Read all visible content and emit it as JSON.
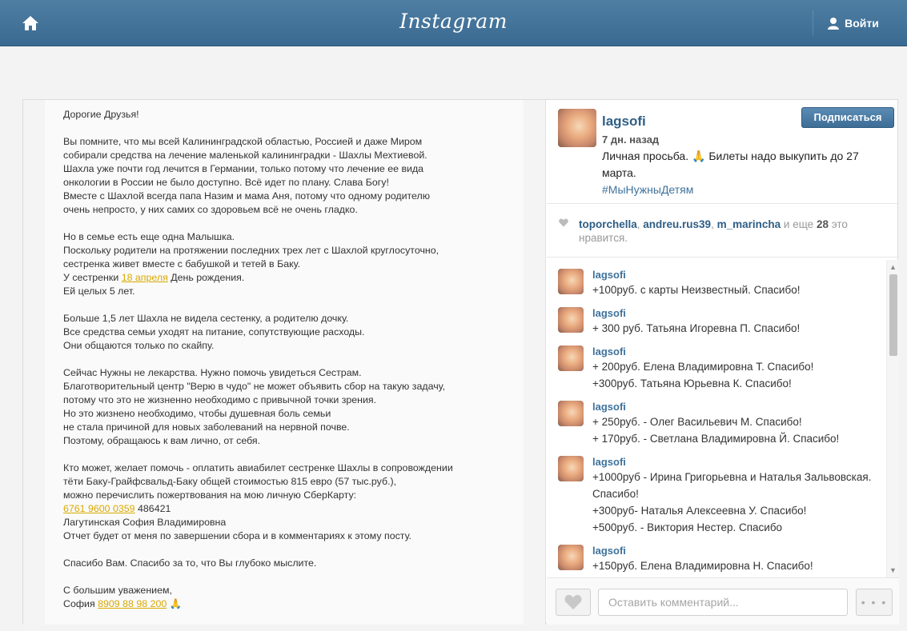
{
  "topbar": {
    "logo": "Instagram",
    "login_label": "Войти"
  },
  "letter": {
    "paragraphs": [
      [
        {
          "text": "Дорогие Друзья!"
        }
      ],
      [
        {
          "text": "Вы помните, что мы всей Калининградской областью, Россией и даже Миром"
        },
        {
          "text": "собирали средства на лечение маленькой калининградки - Шахлы Мехтиевой."
        },
        {
          "text": "Шахла уже почти год лечится в Германии, только потому что лечение ее вида"
        },
        {
          "text": "онкологии в России не было доступно. Всё идет по плану. Слава Богу!"
        },
        {
          "text": "Вместе с Шахлой всегда папа Назим и мама Аня, потому что одному родителю"
        },
        {
          "text": "очень непросто, у них самих со здоровьем всё не очень гладко."
        }
      ],
      [
        {
          "text": "Но в семье есть еще одна Малышка."
        },
        {
          "text": "Поскольку родители на протяжении последних трех лет с Шахлой круглосуточно,"
        },
        {
          "text": "сестренка живет вместе с бабушкой и тетей в Баку."
        },
        {
          "text": "У сестренки ",
          "hl": "18 апреля",
          "tail": " День рождения."
        },
        {
          "text": "Ей целых 5 лет."
        }
      ],
      [
        {
          "text": "Больше 1,5 лет Шахла не видела сестенку, а родителю дочку."
        },
        {
          "text": "Все средства семьи уходят на питание, сопутствующие расходы."
        },
        {
          "text": "Они общаются только по скайпу."
        }
      ],
      [
        {
          "text": "Сейчас Нужны не лекарства. Нужно помочь увидеться Сестрам."
        },
        {
          "text": "Благотворительный центр \"Верю в чудо\" не может объявить сбор на такую задачу,"
        },
        {
          "text": "потому что это не жизненно необходимо с привычной точки зрения."
        },
        {
          "text": "Но это жизнено необходимо, чтобы душевная боль семьи"
        },
        {
          "text": "не стала причиной для новых заболеваний на нервной почве."
        },
        {
          "text": "Поэтому, обращаюсь к вам лично, от себя."
        }
      ],
      [
        {
          "text": "Кто может, желает помочь - оплатить авиабилет  сестренке Шахлы в сопровождении"
        },
        {
          "text": "тёти Баку-Грайфсвальд-Баку  общей стоимостью 815 евро (57 тыс.руб.),"
        },
        {
          "text": "можно перечислить пожертвования на мою личную СберКарту:"
        },
        {
          "text": "",
          "hl": "6761 9600 0359",
          "tail": " 486421"
        },
        {
          "text": "Лагутинская София Владимировна"
        },
        {
          "text": "Отчет будет от меня по завершении сбора и в комментариях к этому посту."
        }
      ],
      [
        {
          "text": "Спасибо Вам. Спасибо за то, что Вы глубоко мыслите."
        }
      ],
      [
        {
          "text": "С большим уважением,"
        },
        {
          "text": "София  ",
          "hl": "8909 88 98 200",
          "tail": " 🙏"
        }
      ]
    ]
  },
  "post": {
    "username": "lagsofi",
    "follow_label": "Подписаться",
    "time": "7 дн. назад",
    "caption": "Личная просьба. 🙏 Билеты надо выкупить до 27 марта.",
    "hashtag": "#МыНужныДетям"
  },
  "likes": {
    "users": [
      "toporchella",
      "andreu.rus39",
      "m_marincha"
    ],
    "and_more": "и еще",
    "count": "28",
    "suffix": "это нравится."
  },
  "comments": [
    {
      "user": "lagsofi",
      "lines": [
        "+100руб. с карты Неизвестный. Спасибо!"
      ]
    },
    {
      "user": "lagsofi",
      "lines": [
        "+ 300 руб. Татьяна Игоревна П. Спасибо!"
      ]
    },
    {
      "user": "lagsofi",
      "lines": [
        "+ 200руб. Елена Владимировна Т. Спасибо!",
        "+300руб. Татьяна Юрьевна К. Спасибо!"
      ]
    },
    {
      "user": "lagsofi",
      "lines": [
        "+ 250руб. - Олег Васильевич М. Спасибо!",
        "+ 170руб. - Светлана Владимировна Й. Спасибо!"
      ]
    },
    {
      "user": "lagsofi",
      "lines": [
        "+1000руб - Ирина Григорьевна и Наталья Зальвовская. Спасибо!",
        "+300руб- Наталья Алексеевна У. Спасибо!",
        "+500руб. - Виктория Нестер. Спасибо"
      ]
    },
    {
      "user": "lagsofi",
      "lines": [
        "+150руб. Елена Владимировна Н. Спасибо!"
      ]
    }
  ],
  "comment_box": {
    "placeholder": "Оставить комментарий...",
    "more_label": "• • •"
  },
  "colors": {
    "topbar": "#3f6e94",
    "link": "#3f729b",
    "highlight": "#d9a900",
    "follow": "#3d6d96"
  }
}
